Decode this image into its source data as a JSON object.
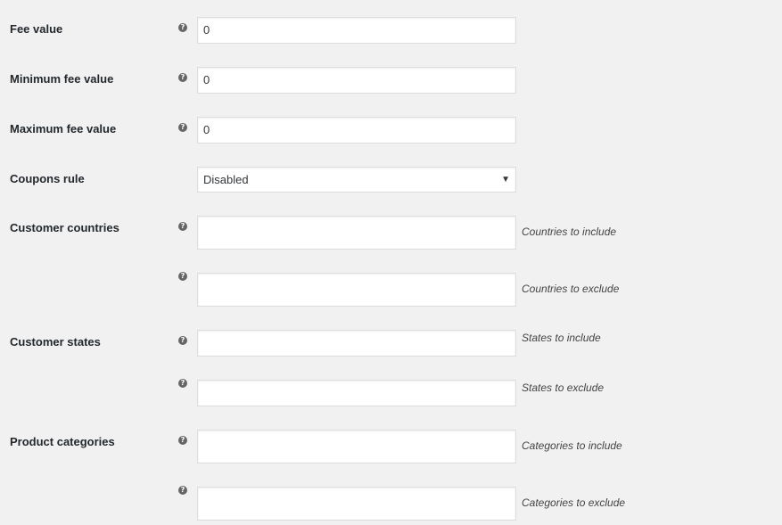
{
  "rows": {
    "fee_value": {
      "label": "Fee value",
      "value": "0"
    },
    "min_fee": {
      "label": "Minimum fee value",
      "value": "0"
    },
    "max_fee": {
      "label": "Maximum fee value",
      "value": "0"
    },
    "coupons": {
      "label": "Coupons rule",
      "selected": "Disabled"
    },
    "countries": {
      "label": "Customer countries",
      "include_hint": "Countries to include",
      "exclude_hint": "Countries to exclude"
    },
    "states": {
      "label": "Customer states",
      "include_hint": "States to include",
      "exclude_hint": "States to exclude"
    },
    "categories": {
      "label": "Product categories",
      "include_hint": "Categories to include",
      "exclude_hint": "Categories to exclude"
    }
  },
  "help_glyph": "?",
  "select_arrow_glyph": "▼",
  "icons": {
    "help": "help-tip-icon",
    "dropdown": "chevron-down-icon"
  },
  "colors": {
    "background": "#f1f1f1",
    "field_border": "#dddddd",
    "help_icon": "#666666"
  }
}
